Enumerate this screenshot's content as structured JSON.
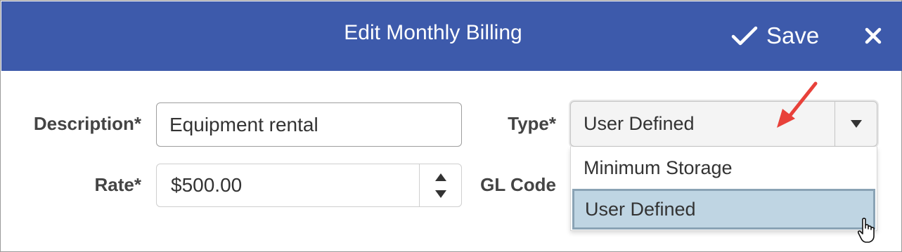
{
  "dialog": {
    "title": "Edit Monthly Billing",
    "save_label": "Save",
    "colors": {
      "header": "#3d5aab",
      "selected_option": "#bfd5e3",
      "annotation_arrow": "#e8413a"
    }
  },
  "form": {
    "description": {
      "label": "Description*",
      "value": "Equipment rental"
    },
    "rate": {
      "label": "Rate*",
      "value": "$500.00"
    },
    "type": {
      "label": "Type*",
      "value": "User Defined",
      "options": [
        "Minimum Storage",
        "User Defined"
      ],
      "highlighted_option": "User Defined"
    },
    "gl_code": {
      "label": "GL Code"
    }
  },
  "icons": [
    "check-icon",
    "close-icon",
    "caret-down-icon",
    "spinner-up-icon",
    "spinner-down-icon",
    "hand-cursor-icon",
    "annotation-arrow-icon"
  ]
}
